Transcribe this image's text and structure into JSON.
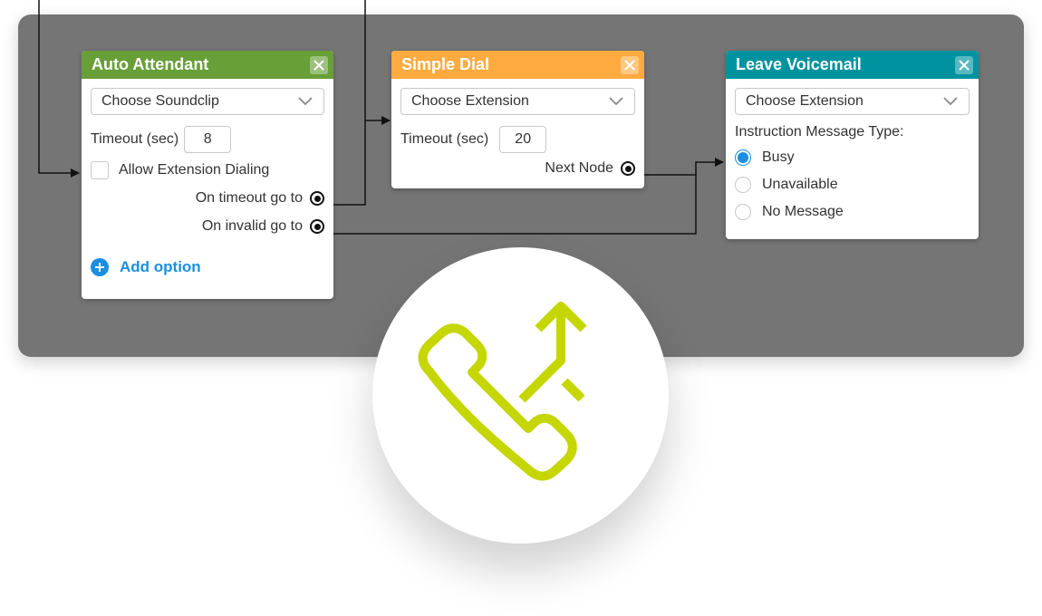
{
  "colors": {
    "canvas": "#757575",
    "auto_attendant": "#689f38",
    "simple_dial": "#ffab40",
    "leave_voicemail": "#00939f",
    "accent_blue": "#1a8fe3",
    "icon_lime": "#c5d600"
  },
  "nodes": {
    "auto_attendant": {
      "title": "Auto Attendant",
      "select_label": "Choose Soundclip",
      "timeout_label": "Timeout (sec)",
      "timeout_value": "8",
      "checkbox_label": "Allow Extension Dialing",
      "checkbox_checked": false,
      "ports": [
        "On timeout go to",
        "On invalid go to"
      ],
      "add_option_label": "Add option"
    },
    "simple_dial": {
      "title": "Simple Dial",
      "select_label": "Choose Extension",
      "timeout_label": "Timeout (sec)",
      "timeout_value": "20",
      "port_label": "Next Node"
    },
    "leave_voicemail": {
      "title": "Leave Voicemail",
      "select_label": "Choose Extension",
      "instruction_label": "Instruction Message Type:",
      "options": [
        "Busy",
        "Unavailable",
        "No Message"
      ],
      "selected_option": "Busy"
    }
  },
  "badge": {
    "icon": "phone-forward-icon"
  }
}
